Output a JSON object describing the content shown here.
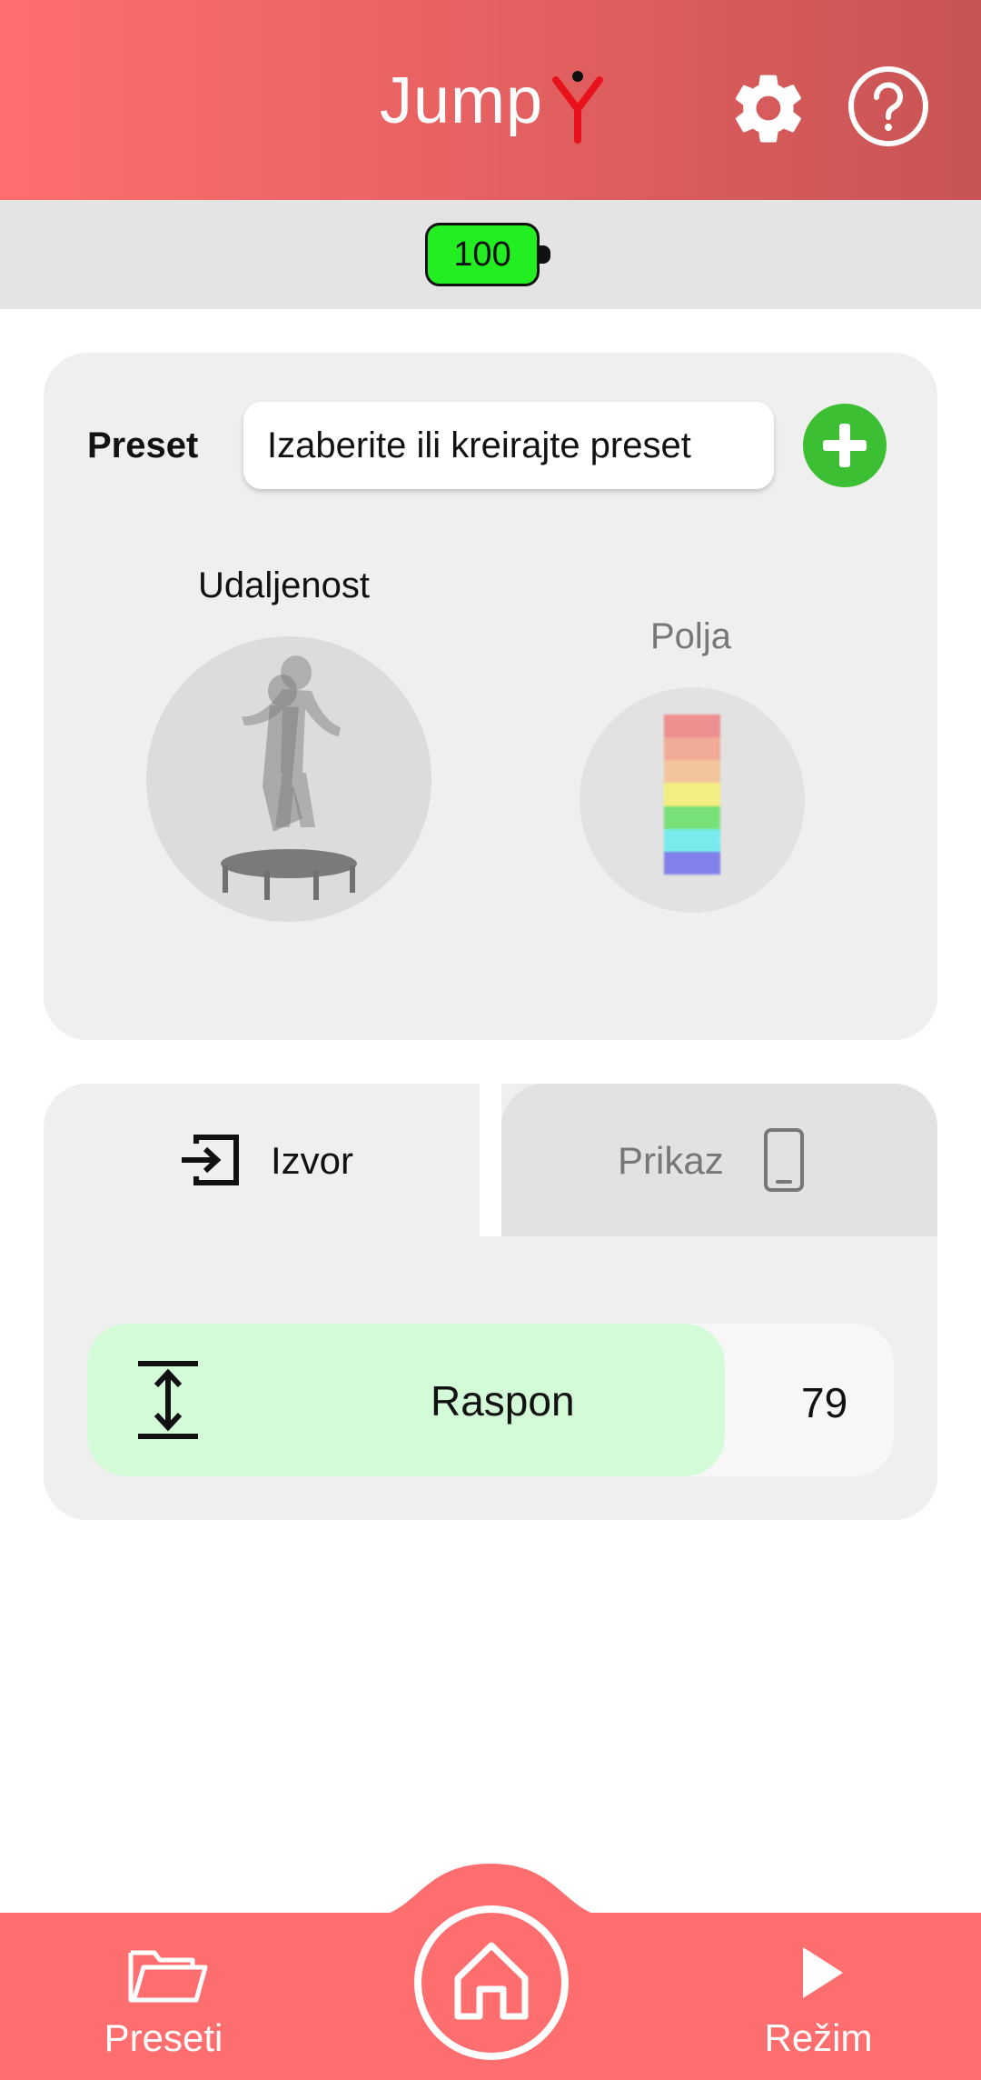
{
  "header": {
    "app_title": "Jump",
    "settings_icon": "gear-icon",
    "help_icon": "help-circle-icon"
  },
  "battery": {
    "level": "100",
    "color": "#22ee22"
  },
  "preset": {
    "label": "Preset",
    "select_value": "Izaberite ili kreirajte preset",
    "add_icon": "plus-circle-icon"
  },
  "modes": {
    "distance_label": "Udaljenost",
    "fields_label": "Polja",
    "field_colors": [
      "#f08080",
      "#f4a08a",
      "#f6c090",
      "#f6f070",
      "#66e066",
      "#66eeee",
      "#7070ee"
    ]
  },
  "tabs": [
    {
      "label": "Izvor",
      "icon": "input-icon",
      "active": true
    },
    {
      "label": "Prikaz",
      "icon": "phone-icon",
      "active": false
    }
  ],
  "range": {
    "label": "Raspon",
    "value": "79",
    "fill_fraction": 0.79,
    "icon": "vertical-range-icon"
  },
  "bottom_nav": {
    "preseti_label": "Preseti",
    "home_icon": "home-icon",
    "rezim_label": "Režim"
  },
  "colors": {
    "accent": "#ff6e6e",
    "add_button": "#3cbf32",
    "range_fill": "#d4fbd8"
  }
}
